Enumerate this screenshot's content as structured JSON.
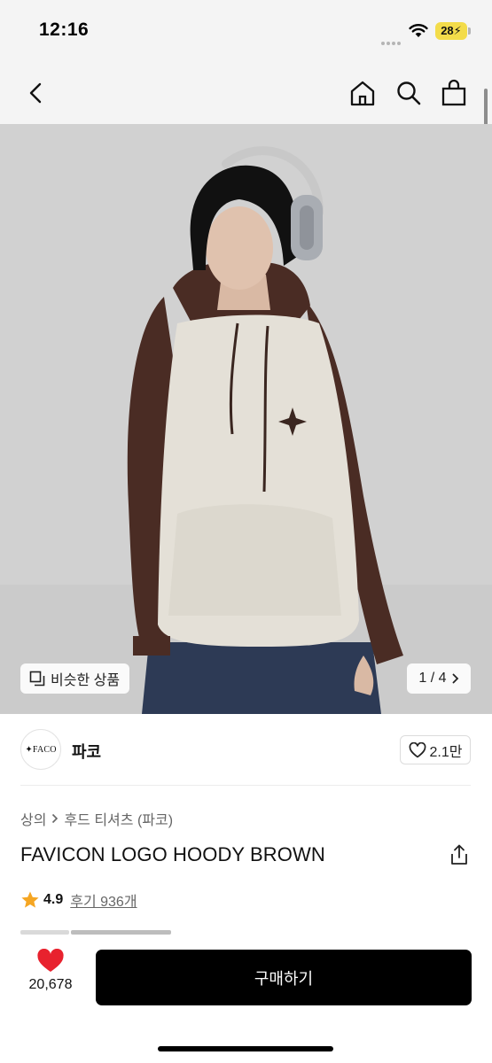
{
  "status_bar": {
    "time": "12:16",
    "battery": "28",
    "icons": [
      "wifi-icon",
      "battery-icon",
      "signal-dots"
    ]
  },
  "nav": {
    "icons": [
      "back-icon",
      "home-icon",
      "search-icon",
      "shopping-bag-icon"
    ]
  },
  "hero": {
    "similar_label": "비슷한 상품",
    "page_indicator": "1 / 4",
    "colors": {
      "background": "#cfcfcf",
      "body": "#e4e0d7",
      "sleeves": "#4a2c24"
    }
  },
  "brand": {
    "logo_text": "✦FACO",
    "name": "파코",
    "like_count": "2.1만"
  },
  "product": {
    "breadcrumb": [
      "상의",
      "후드 티셔츠 (파코)"
    ],
    "title": "FAVICON LOGO HOODY BROWN",
    "rating": "4.9",
    "reviews": "후기 936개"
  },
  "bottom_bar": {
    "wish_count": "20,678",
    "buy_label": "구매하기",
    "colors": {
      "heart": "#e8222e",
      "button": "#000000"
    }
  }
}
